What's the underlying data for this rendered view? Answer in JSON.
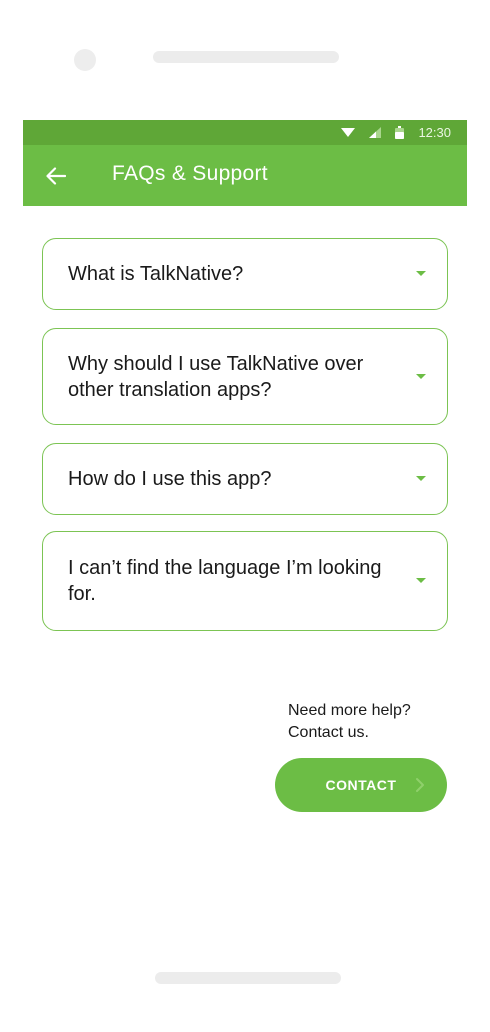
{
  "status_bar": {
    "time": "12:30",
    "icons": [
      "wifi-icon",
      "signal-icon",
      "battery-icon"
    ]
  },
  "app_bar": {
    "title": "FAQs & Support",
    "back_icon": "arrow-left-icon"
  },
  "faq": {
    "items": [
      {
        "question": "What is TalkNative?"
      },
      {
        "question": "Why should I use TalkNative over other translation apps?"
      },
      {
        "question": "How do I use this app?"
      },
      {
        "question": "I can’t find the language I’m looking for."
      }
    ]
  },
  "help": {
    "line1": "Need more help?",
    "line2": "Contact us."
  },
  "contact_button": {
    "label": "CONTACT"
  },
  "colors": {
    "primary": "#6cbd45",
    "status_bar": "#5fa737",
    "border": "#7cc454"
  }
}
